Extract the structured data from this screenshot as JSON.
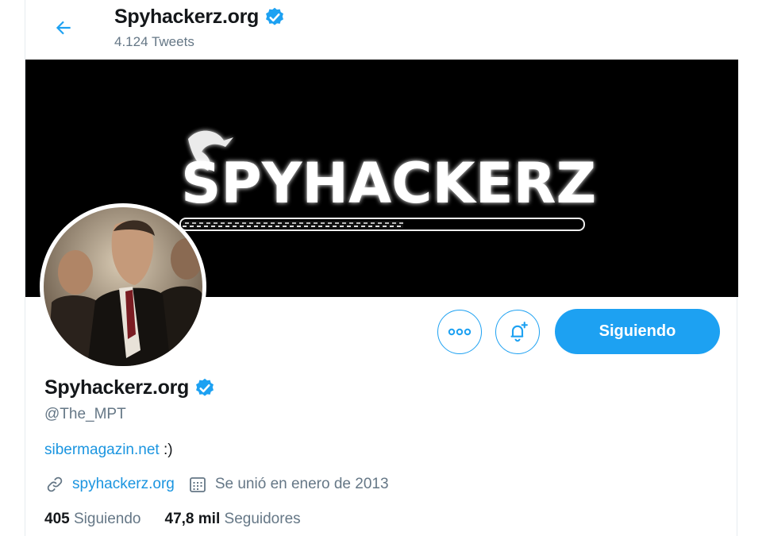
{
  "header": {
    "title": "Spyhackerz.org",
    "tweets_label": "4.124 Tweets"
  },
  "banner": {
    "logo_text": "SPYHACKERZ"
  },
  "actions": {
    "follow_label": "Siguiendo"
  },
  "profile": {
    "name": "Spyhackerz.org",
    "handle": "@The_MPT",
    "bio_link": "sibermagazin.net",
    "bio_rest": " :)",
    "website": "spyhackerz.org",
    "joined": "Se unió en enero de 2013"
  },
  "stats": {
    "following_count": "405",
    "following_label": "Siguiendo",
    "followers_count": "47,8 mil",
    "followers_label": "Seguidores"
  },
  "colors": {
    "accent": "#1da1f2",
    "link": "#1b95e0",
    "muted": "#657786"
  },
  "icons": [
    "back-arrow-icon",
    "verified-badge-icon",
    "more-options-icon",
    "notification-bell-icon",
    "link-icon",
    "calendar-icon"
  ]
}
